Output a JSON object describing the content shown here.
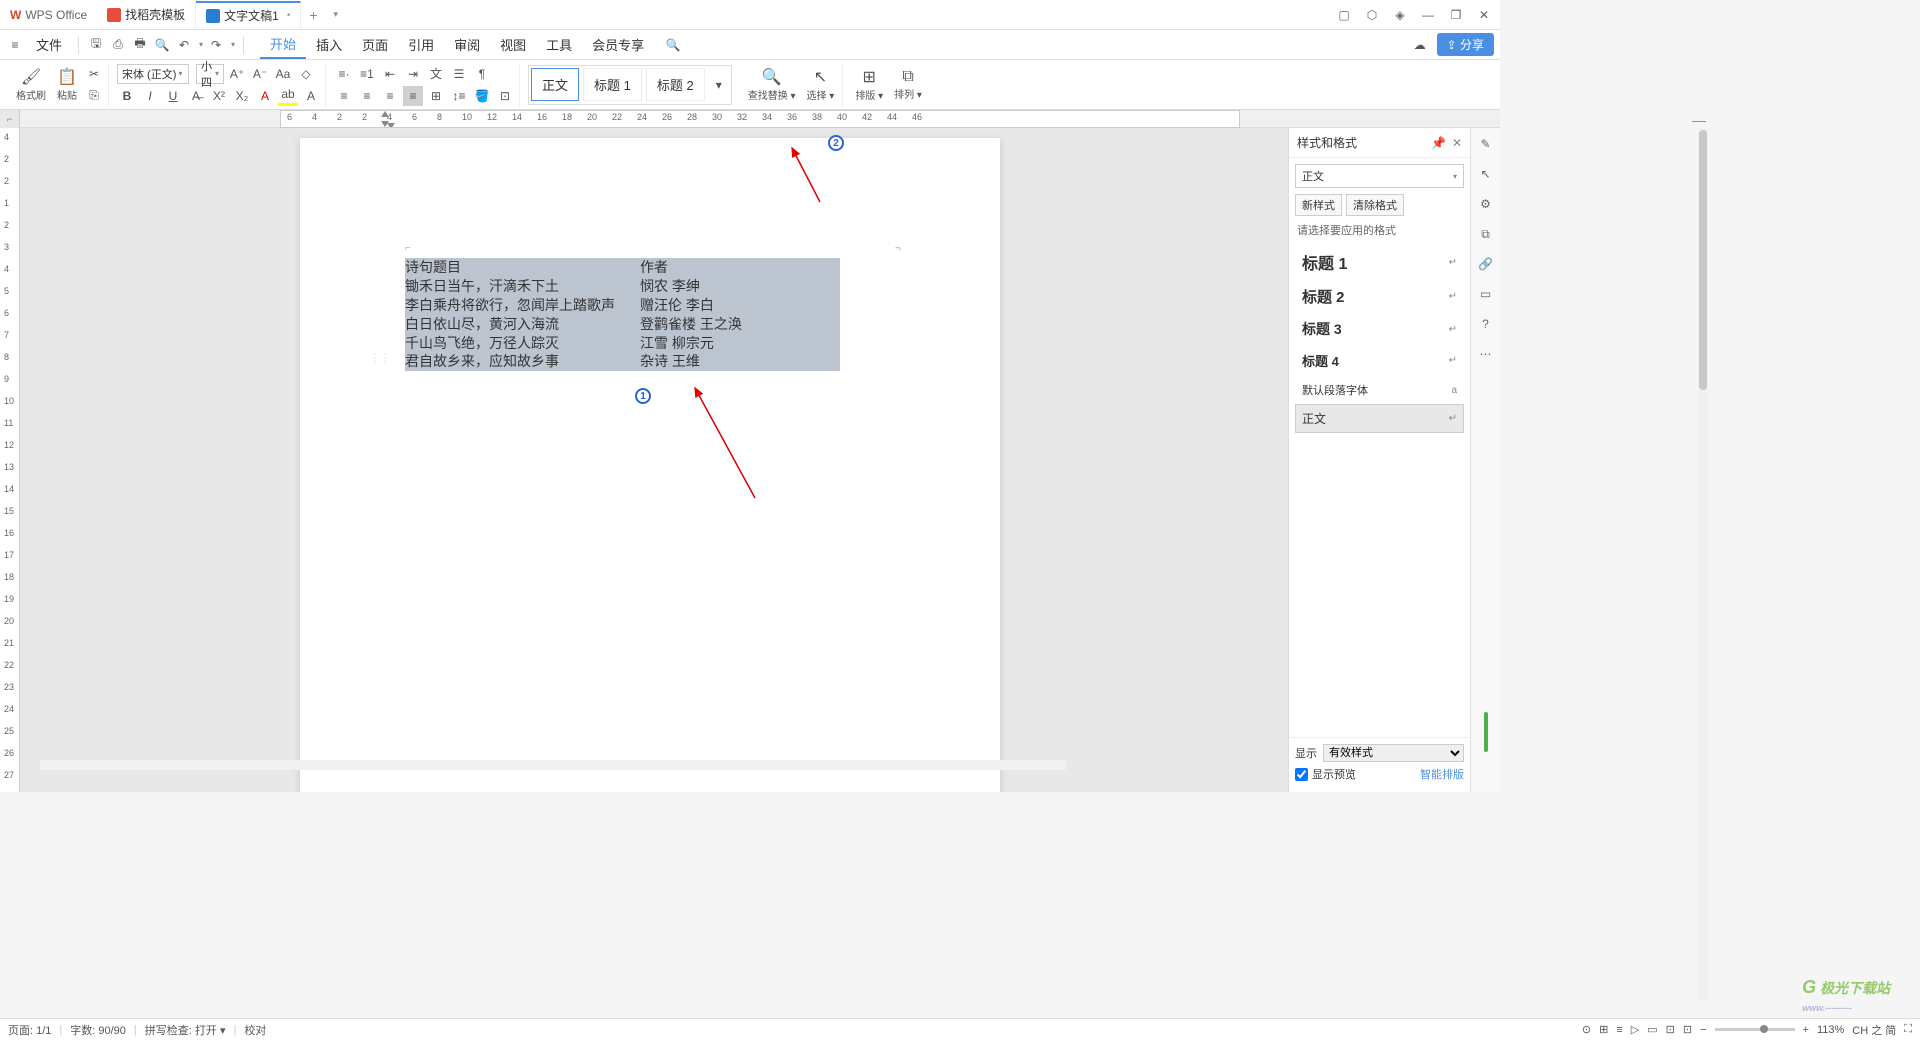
{
  "app": {
    "name": "WPS Office"
  },
  "tabs": [
    {
      "icon": "D",
      "label": "找稻壳模板"
    },
    {
      "icon": "W",
      "label": "文字文稿1",
      "dirty": "•",
      "active": true
    }
  ],
  "window_controls": {
    "minimize": "—",
    "maximize": "❐",
    "close": "✕"
  },
  "titlebar_icons": [
    "▢",
    "⬡",
    "◆"
  ],
  "menubar": {
    "hamburger": "≡",
    "file": "文件",
    "quick": [
      "save",
      "export",
      "print",
      "preview",
      "undo",
      "redo"
    ],
    "items": [
      "开始",
      "插入",
      "页面",
      "引用",
      "审阅",
      "视图",
      "工具",
      "会员专享"
    ],
    "active": "开始",
    "search_icon": "search",
    "cloud": "☁",
    "share": "⇪ 分享"
  },
  "toolbar": {
    "format_brush": "格式刷",
    "paste": "粘贴",
    "font_name": "宋体 (正文)",
    "font_size": "小四",
    "styles": {
      "normal": "正文",
      "h1": "标题 1",
      "h2": "标题 2"
    },
    "find_replace": "查找替换",
    "select": "选择",
    "layout": "排版",
    "arrange": "排列"
  },
  "ruler": {
    "h_ticks": [
      6,
      4,
      2,
      2,
      4,
      6,
      8,
      10,
      12,
      14,
      16,
      18,
      20,
      22,
      24,
      26,
      28,
      30,
      32,
      34,
      36,
      38,
      40,
      42,
      44,
      46
    ],
    "v_ticks": [
      4,
      2,
      2,
      1,
      2,
      3,
      4,
      5,
      6,
      7,
      8,
      9,
      10,
      11,
      12,
      13,
      14,
      15,
      16,
      17,
      18,
      19,
      20,
      21,
      22,
      23,
      24,
      25,
      26,
      27
    ]
  },
  "document": {
    "rows": [
      {
        "col1": "诗句题目",
        "col2": "作者"
      },
      {
        "col1": "锄禾日当午，汗滴禾下土",
        "col2": "悯农  李绅"
      },
      {
        "col1": "李白乘舟将欲行，忽闻岸上踏歌声",
        "col2": "赠汪伦  李白"
      },
      {
        "col1": "白日依山尽，黄河入海流",
        "col2": "登鹳雀楼  王之涣"
      },
      {
        "col1": "千山鸟飞绝，万径人踪灭",
        "col2": "江雪  柳宗元"
      },
      {
        "col1": "君自故乡来，应知故乡事",
        "col2": "杂诗  王维"
      }
    ]
  },
  "annotations": {
    "num1": "1",
    "num2": "2"
  },
  "side_panel": {
    "title": "样式和格式",
    "current": "正文",
    "new_style": "新样式",
    "clear_format": "清除格式",
    "hint": "请选择要应用的格式",
    "list": [
      {
        "name": "标题 1",
        "cls": "style-h1",
        "marker": "↵"
      },
      {
        "name": "标题 2",
        "cls": "style-h2",
        "marker": "↵"
      },
      {
        "name": "标题 3",
        "cls": "style-h3",
        "marker": "↵"
      },
      {
        "name": "标题 4",
        "cls": "style-h4",
        "marker": "↵"
      },
      {
        "name": "默认段落字体",
        "cls": "style-default",
        "marker": "a"
      },
      {
        "name": "正文",
        "cls": "style-normal",
        "marker": "↵",
        "selected": true
      }
    ],
    "show_label": "显示",
    "show_value": "有效样式",
    "preview_label": "显示预览",
    "smart_layout": "智能排版"
  },
  "statusbar": {
    "page": "页面: 1/1",
    "words": "字数: 90/90",
    "spell": "拼写检查: 打开",
    "proof": "校对",
    "zoom": "113%",
    "ime": "CH 之 简"
  },
  "watermark": "极光下载站"
}
